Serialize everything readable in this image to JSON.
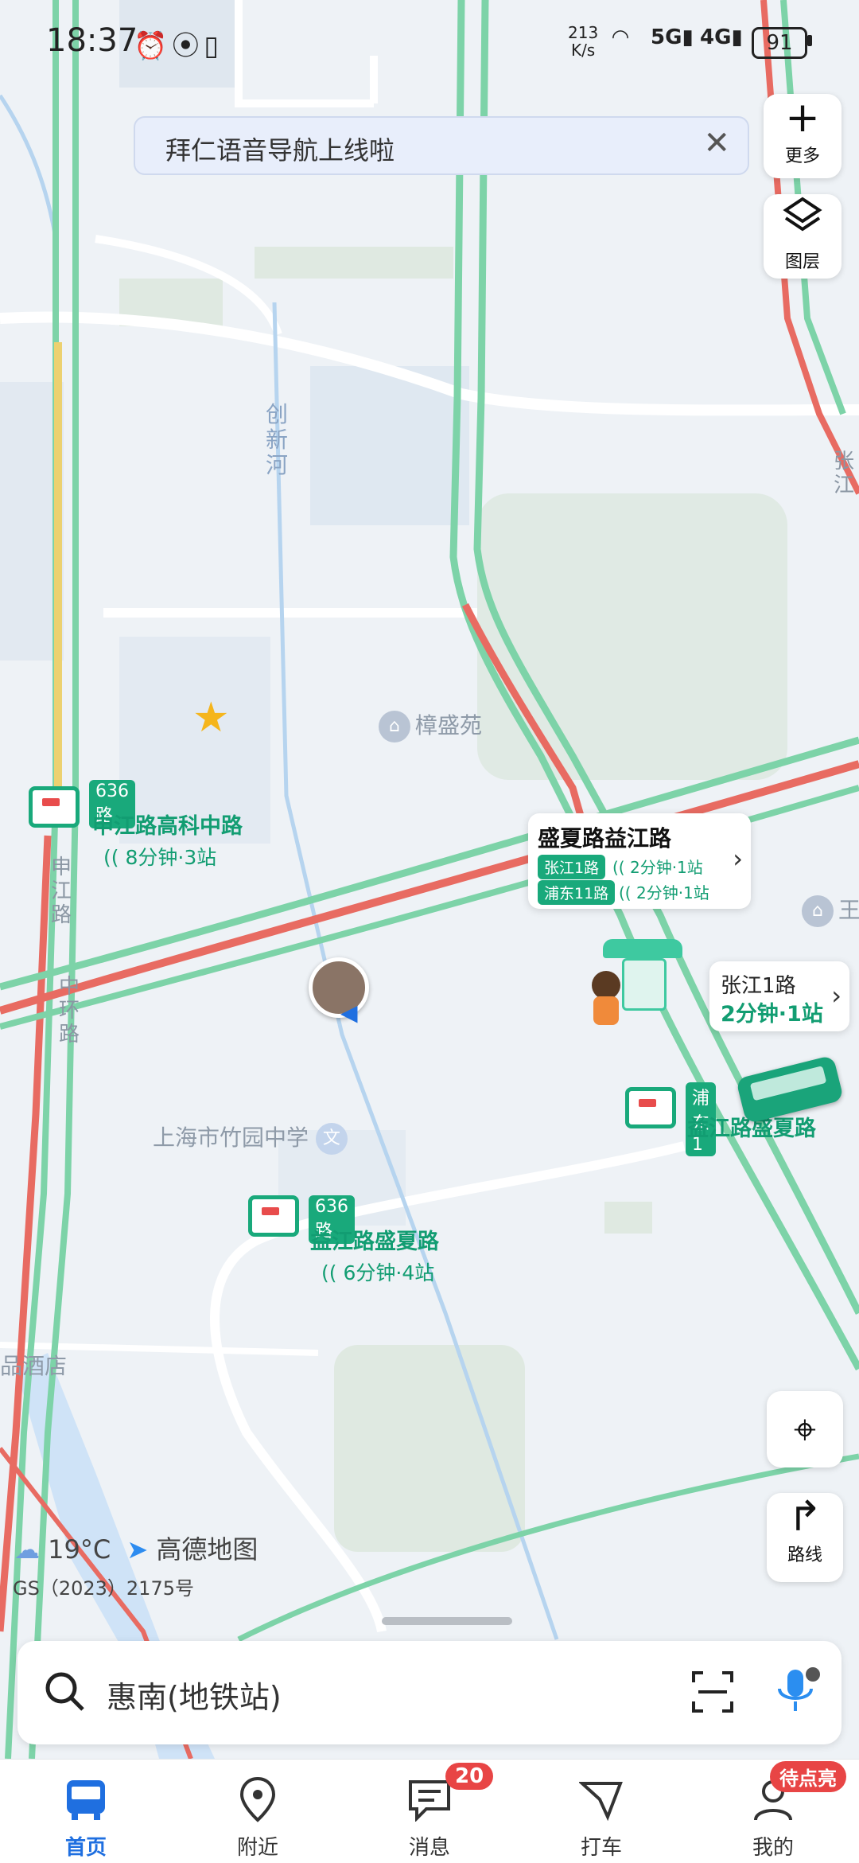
{
  "status_bar": {
    "time": "18:37",
    "net_speed_value": "213",
    "net_speed_unit": "K/s",
    "signal1": "5G",
    "signal2": "4G",
    "battery": "91"
  },
  "banner": {
    "text": "拜仁语音导航上线啦",
    "close": "✕"
  },
  "side_buttons": {
    "more": "更多",
    "layers": "图层",
    "route": "路线"
  },
  "map_labels": {
    "river": "创\n新\n河",
    "poi_zhangshengyuan": "樟盛苑",
    "school": "上海市竹园中学",
    "school_icon": "文",
    "hotel": "品酒店",
    "road_shenjiang": "申\n江\n路",
    "road_zhonghuan": "中\n环\n路",
    "road_zhang": "张\n江",
    "poi_wang": "王"
  },
  "bus_stops": [
    {
      "route": "636路",
      "name": "申江路高科中路",
      "eta": "8分钟·3站"
    },
    {
      "route": "636路",
      "name": "益江路盛夏路",
      "eta": "6分钟·4站"
    },
    {
      "route": "浦东1",
      "name": "益江路盛夏路"
    }
  ],
  "callout_main": {
    "title": "盛夏路益江路",
    "rows": [
      {
        "route": "张江1路",
        "eta": "2分钟·1站"
      },
      {
        "route": "浦东11路",
        "eta": "2分钟·1站"
      }
    ]
  },
  "callout_small": {
    "route": "张江1路",
    "eta": "2分钟·1站"
  },
  "weather": {
    "temp": "19°C",
    "brand": "高德地图",
    "license": "GS（2023）2175号"
  },
  "search": {
    "placeholder": "惠南(地铁站)"
  },
  "tabs": [
    {
      "label": "首页"
    },
    {
      "label": "附近"
    },
    {
      "label": "消息",
      "badge": "20"
    },
    {
      "label": "打车"
    },
    {
      "label": "我的",
      "badge": "待点亮"
    }
  ],
  "colors": {
    "accent": "#1f6fe0",
    "bus_green": "#19a97b",
    "road_red": "#e86b62",
    "road_green": "#7dd3a8",
    "road_yellow": "#ecd170"
  }
}
